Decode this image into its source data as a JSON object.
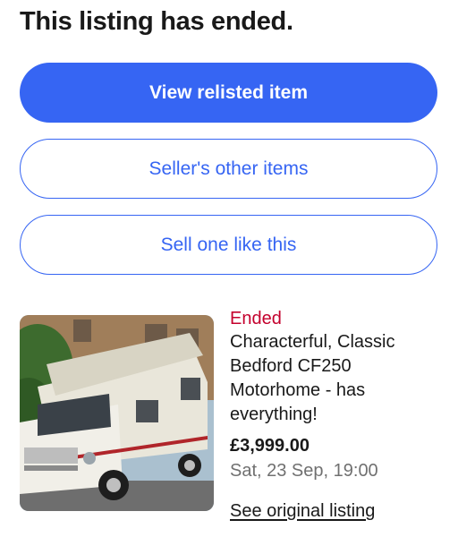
{
  "heading": "This listing has ended.",
  "buttons": {
    "view_relisted": "View relisted item",
    "sellers_other": "Seller's other items",
    "sell_one": "Sell one like this"
  },
  "listing": {
    "status": "Ended",
    "title": "Characterful, Classic Bedford CF250 Motorhome - has everything!",
    "price": "£3,999.00",
    "end_date": "Sat, 23 Sep, 19:00",
    "image_description": "camper-van-photo",
    "link": "See original listing"
  },
  "colors": {
    "primary": "#3665f3",
    "ended": "#c4002d",
    "muted": "#707070",
    "text": "#191919"
  }
}
